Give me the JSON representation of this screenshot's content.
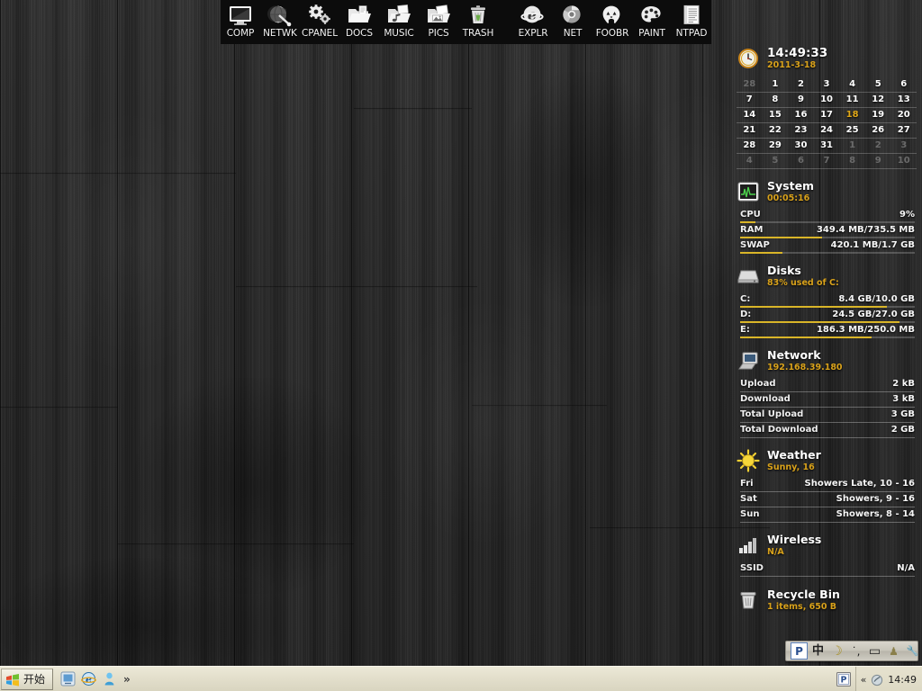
{
  "dock": {
    "group1": [
      {
        "label": "COMP",
        "icon": "monitor-icon"
      },
      {
        "label": "NETWK",
        "icon": "network-globe-icon"
      },
      {
        "label": "CPANEL",
        "icon": "gears-icon"
      },
      {
        "label": "DOCS",
        "icon": "documents-folder-icon"
      },
      {
        "label": "MUSIC",
        "icon": "music-folder-icon"
      },
      {
        "label": "PICS",
        "icon": "pictures-folder-icon"
      },
      {
        "label": "TRASH",
        "icon": "trash-bin-icon"
      }
    ],
    "group2": [
      {
        "label": "EXPLR",
        "icon": "internet-explorer-icon"
      },
      {
        "label": "NET",
        "icon": "chrome-browser-icon"
      },
      {
        "label": "FOOBR",
        "icon": "foobar2000-icon"
      },
      {
        "label": "PAINT",
        "icon": "paint-palette-icon"
      },
      {
        "label": "NTPAD",
        "icon": "notepad-icon"
      }
    ]
  },
  "sidebar": {
    "clock": {
      "icon": "clock-icon",
      "time": "14:49:33",
      "date": "2011-3-18"
    },
    "calendar": {
      "today": "18",
      "weeks": [
        [
          {
            "d": "28",
            "s": "dim"
          },
          {
            "d": "1",
            "s": ""
          },
          {
            "d": "2",
            "s": ""
          },
          {
            "d": "3",
            "s": ""
          },
          {
            "d": "4",
            "s": ""
          },
          {
            "d": "5",
            "s": ""
          },
          {
            "d": "6",
            "s": ""
          }
        ],
        [
          {
            "d": "7",
            "s": ""
          },
          {
            "d": "8",
            "s": ""
          },
          {
            "d": "9",
            "s": ""
          },
          {
            "d": "10",
            "s": ""
          },
          {
            "d": "11",
            "s": ""
          },
          {
            "d": "12",
            "s": ""
          },
          {
            "d": "13",
            "s": ""
          }
        ],
        [
          {
            "d": "14",
            "s": ""
          },
          {
            "d": "15",
            "s": ""
          },
          {
            "d": "16",
            "s": ""
          },
          {
            "d": "17",
            "s": ""
          },
          {
            "d": "18",
            "s": "today"
          },
          {
            "d": "19",
            "s": ""
          },
          {
            "d": "20",
            "s": ""
          }
        ],
        [
          {
            "d": "21",
            "s": ""
          },
          {
            "d": "22",
            "s": ""
          },
          {
            "d": "23",
            "s": ""
          },
          {
            "d": "24",
            "s": ""
          },
          {
            "d": "25",
            "s": ""
          },
          {
            "d": "26",
            "s": ""
          },
          {
            "d": "27",
            "s": ""
          }
        ],
        [
          {
            "d": "28",
            "s": ""
          },
          {
            "d": "29",
            "s": ""
          },
          {
            "d": "30",
            "s": ""
          },
          {
            "d": "31",
            "s": ""
          },
          {
            "d": "1",
            "s": "dim"
          },
          {
            "d": "2",
            "s": "dim"
          },
          {
            "d": "3",
            "s": "dim"
          }
        ],
        [
          {
            "d": "4",
            "s": "dim"
          },
          {
            "d": "5",
            "s": "dim"
          },
          {
            "d": "6",
            "s": "dim"
          },
          {
            "d": "7",
            "s": "dim"
          },
          {
            "d": "8",
            "s": "dim"
          },
          {
            "d": "9",
            "s": "dim"
          },
          {
            "d": "10",
            "s": "dim"
          }
        ]
      ]
    },
    "system": {
      "icon": "system-monitor-icon",
      "title": "System",
      "uptime": "00:05:16",
      "rows": [
        {
          "label": "CPU",
          "value": "9%",
          "pct": 9
        },
        {
          "label": "RAM",
          "value": "349.4 MB/735.5 MB",
          "pct": 47
        },
        {
          "label": "SWAP",
          "value": "420.1 MB/1.7 GB",
          "pct": 24
        }
      ]
    },
    "disks": {
      "icon": "hard-disk-icon",
      "title": "Disks",
      "summary": "83% used of C:",
      "rows": [
        {
          "label": "C:",
          "value": "8.4 GB/10.0 GB",
          "pct": 84
        },
        {
          "label": "D:",
          "value": "24.5 GB/27.0 GB",
          "pct": 91
        },
        {
          "label": "E:",
          "value": "186.3 MB/250.0 MB",
          "pct": 75
        }
      ]
    },
    "network": {
      "icon": "network-computer-icon",
      "title": "Network",
      "ip": "192.168.39.180",
      "rows": [
        {
          "label": "Upload",
          "value": "2 kB"
        },
        {
          "label": "Download",
          "value": "3 kB"
        },
        {
          "label": "Total Upload",
          "value": "3 GB"
        },
        {
          "label": "Total Download",
          "value": "2 GB"
        }
      ]
    },
    "weather": {
      "icon": "sun-icon",
      "title": "Weather",
      "current": "Sunny, 16",
      "rows": [
        {
          "label": "Fri",
          "value": "Showers Late, 10 - 16"
        },
        {
          "label": "Sat",
          "value": "Showers, 9 - 16"
        },
        {
          "label": "Sun",
          "value": "Showers, 8 - 14"
        }
      ]
    },
    "wireless": {
      "icon": "signal-bars-icon",
      "title": "Wireless",
      "status": "N/A",
      "rows": [
        {
          "label": "SSID",
          "value": "N/A"
        }
      ]
    },
    "recycle": {
      "icon": "recycle-bin-icon",
      "title": "Recycle Bin",
      "status": "1  items, 650 B"
    }
  },
  "ime": {
    "items": [
      {
        "name": "ime-logo-icon",
        "glyph": "P"
      },
      {
        "name": "ime-chinese-mode",
        "glyph": "中"
      },
      {
        "name": "ime-halfwidth-icon",
        "glyph": "☽"
      },
      {
        "name": "ime-punctuation-icon",
        "glyph": "˙,"
      },
      {
        "name": "ime-keyboard-icon",
        "glyph": "▭"
      },
      {
        "name": "ime-user-icon",
        "glyph": "♟"
      },
      {
        "name": "ime-settings-icon",
        "glyph": "🔧"
      }
    ]
  },
  "taskbar": {
    "start_label": "开始",
    "quicklaunch": [
      {
        "name": "ql-show-desktop-icon"
      },
      {
        "name": "ql-internet-explorer-icon"
      },
      {
        "name": "ql-messenger-icon"
      }
    ],
    "overflow_glyph": "»",
    "tray_app": "P",
    "tray_chevron": "«",
    "clock": "14:49"
  },
  "colors": {
    "accent_yellow": "#d9a21b",
    "bar_yellow": "#d9b528",
    "dock_bg": "#0c0c0c",
    "taskbar_bg": "#ece9d8",
    "text_white": "#ffffff"
  }
}
